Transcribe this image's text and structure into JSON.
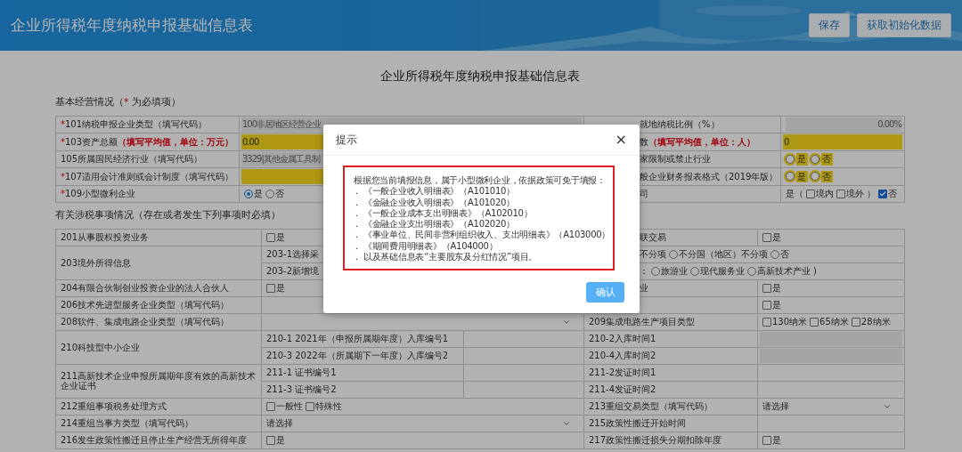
{
  "header": {
    "title": "企业所得税年度纳税申报基础信息表",
    "buttons": [
      "保存",
      "获取初始化数据"
    ]
  },
  "page_title": "企业所得税年度纳税申报基础信息表",
  "tables": [
    {
      "kind": "basic",
      "title": "基本经营情况（",
      "mark": "*",
      "title_end": " 为必填项）",
      "groups": [
        {
          "label": {
            "kind": "label",
            "mark": "*",
            "text": "101纳税申报企业类型（填写代码）"
          },
          "rows": [
            [
              {
                "kind": "value",
                "parts": [
                  {
                    "kind": "readonly_input",
                    "value": "100非居地区经营企业"
                  }
                ]
              },
              {
                "kind": "label",
                "covered": true,
                "text": "就地纳税比例（%）"
              },
              {
                "kind": "value",
                "parts": [
                  {
                    "kind": "readonly_number",
                    "value": "0.00%"
                  }
                ]
              }
            ]
          ]
        },
        {
          "label": {
            "kind": "label",
            "mark": "*",
            "text": "103资产总额",
            "note": "（填写平均值，单位：万元）"
          },
          "rows": [
            [
              {
                "kind": "value",
                "parts": [
                  {
                    "kind": "required_input",
                    "value": "0.00"
                  }
                ]
              },
              {
                "kind": "label",
                "covered": true,
                "text": "数",
                "note": "（填写平均值，单位：人）"
              },
              {
                "kind": "value",
                "parts": [
                  {
                    "kind": "required_input",
                    "value": "0"
                  }
                ]
              }
            ]
          ]
        },
        {
          "label": {
            "kind": "label",
            "text": "105所属国民经济行业（填写代码）"
          },
          "rows": [
            [
              {
                "kind": "value",
                "parts": [
                  {
                    "kind": "readonly_input",
                    "value": "3329|其他金属工具制"
                  }
                ]
              },
              {
                "kind": "label",
                "covered": true,
                "text": "家限制或禁止行业"
              },
              {
                "kind": "value",
                "parts": [
                  {
                    "kind": "radio",
                    "label": "是",
                    "selected": false,
                    "highlighted": true
                  },
                  {
                    "kind": "radio",
                    "label": "否",
                    "selected": false,
                    "highlighted": true
                  }
                ]
              }
            ]
          ]
        },
        {
          "label": {
            "kind": "label",
            "mark": "*",
            "text": "107适用会计准则或会计制度（填写代码）"
          },
          "rows": [
            [
              {
                "kind": "value",
                "parts": [
                  {
                    "kind": "required_input"
                  }
                ]
              },
              {
                "kind": "label",
                "covered": true,
                "text": "般企业财务报表格式（2019年版）"
              },
              {
                "kind": "value",
                "parts": [
                  {
                    "kind": "radio",
                    "label": "是",
                    "selected": false,
                    "highlighted": true
                  },
                  {
                    "kind": "radio",
                    "label": "否",
                    "selected": false,
                    "highlighted": true
                  }
                ]
              }
            ]
          ]
        },
        {
          "label": {
            "kind": "label",
            "mark": "*",
            "text": "109小型微利企业"
          },
          "rows": [
            [
              {
                "kind": "value",
                "parts": [
                  {
                    "kind": "radio",
                    "label": "是",
                    "selected": true,
                    "highlighted": false
                  },
                  {
                    "kind": "radio",
                    "label": "否",
                    "selected": false,
                    "highlighted": false
                  }
                ]
              },
              {
                "kind": "label",
                "covered": true,
                "text": "司"
              },
              {
                "kind": "value",
                "parts": [
                  {
                    "kind": "text",
                    "text": "是（"
                  },
                  {
                    "kind": "check",
                    "label": "境内",
                    "checked": false
                  },
                  {
                    "kind": "check",
                    "label": "境外",
                    "checked": false
                  },
                  {
                    "kind": "text",
                    "text": "）"
                  },
                  {
                    "kind": "check",
                    "label": "否",
                    "checked": true
                  }
                ]
              }
            ]
          ]
        }
      ]
    },
    {
      "kind": "matters",
      "title": "有关涉税事项情况（存在或者发生下列事项时必填）",
      "groups": [
        {
          "label": {
            "kind": "label",
            "text": "201从事股权投资业务"
          },
          "rows": [
            [
              {
                "kind": "value",
                "merged": true,
                "parts": [
                  {
                    "kind": "check",
                    "label": "是",
                    "checked": false
                  }
                ]
              },
              {
                "kind": "label",
                "covered": true,
                "text": "联交易"
              },
              {
                "kind": "value",
                "parts": [
                  {
                    "kind": "check",
                    "label": "是",
                    "checked": false
                  }
                ]
              }
            ]
          ]
        },
        {
          "label": {
            "kind": "label",
            "text": "203境外所得信息"
          },
          "rows": [
            [
              {
                "kind": "label",
                "merged": true,
                "text": "203-1选择采"
              },
              {
                "kind": "value",
                "merged": true,
                "covered": true,
                "parts": [
                  {
                    "kind": "text",
                    "text": "不分项"
                  },
                  {
                    "kind": "radio",
                    "label": "不分国（地区）不分项",
                    "selected": false,
                    "highlighted": false
                  },
                  {
                    "kind": "radio",
                    "label": "否",
                    "selected": false,
                    "highlighted": false
                  }
                ]
              }
            ],
            [
              {
                "kind": "label",
                "merged": true,
                "text": "203-2新增境"
              },
              {
                "kind": "value",
                "merged": true,
                "covered": true,
                "parts": [
                  {
                    "kind": "text",
                    "text": "："
                  },
                  {
                    "kind": "radio",
                    "label": "旅游业",
                    "selected": false,
                    "highlighted": false
                  },
                  {
                    "kind": "radio",
                    "label": "现代服务业",
                    "selected": false,
                    "highlighted": false
                  },
                  {
                    "kind": "radio",
                    "label": "高新技术产业",
                    "selected": false,
                    "highlighted": false
                  },
                  {
                    "kind": "text",
                    "text": ")"
                  }
                ]
              }
            ]
          ]
        },
        {
          "label": {
            "kind": "label",
            "text": "204有限合伙制创业投资企业的法人合伙人"
          },
          "rows": [
            [
              {
                "kind": "value",
                "merged": true,
                "parts": [
                  {
                    "kind": "check",
                    "label": "是",
                    "checked": false
                  }
                ]
              },
              {
                "kind": "label",
                "covered": true,
                "text": "业"
              },
              {
                "kind": "value",
                "parts": [
                  {
                    "kind": "check",
                    "label": "是",
                    "checked": false
                  }
                ]
              }
            ]
          ]
        },
        {
          "label": {
            "kind": "label",
            "text": "206技术先进型服务企业类型（填写代码）"
          },
          "rows": [
            [
              {
                "kind": "value",
                "merged": true
              },
              {
                "kind": "label",
                "covered": true
              },
              {
                "kind": "value",
                "parts": [
                  {
                    "kind": "check",
                    "label": "是",
                    "checked": false
                  }
                ]
              }
            ]
          ]
        },
        {
          "label": {
            "kind": "label",
            "text": "208软件、集成电路企业类型（填写代码）"
          },
          "rows": [
            [
              {
                "kind": "value",
                "merged": true,
                "parts": [
                  {
                    "kind": "select"
                  }
                ]
              },
              {
                "kind": "label",
                "text": "209集成电路生产项目类型"
              },
              {
                "kind": "value",
                "parts": [
                  {
                    "kind": "check",
                    "label": "130纳米",
                    "checked": false
                  },
                  {
                    "kind": "check",
                    "label": "65纳米",
                    "checked": false
                  },
                  {
                    "kind": "check",
                    "label": "28纳米",
                    "checked": false
                  }
                ]
              }
            ]
          ]
        },
        {
          "label": {
            "kind": "label",
            "text": "210科技型中小企业"
          },
          "rows": [
            [
              {
                "kind": "label",
                "text": "210-1  2021年（申报所属期年度）入库编号1"
              },
              {
                "kind": "value"
              },
              {
                "kind": "label",
                "text": "210-2入库时间1"
              },
              {
                "kind": "value",
                "parts": [
                  {
                    "kind": "readonly_input"
                  }
                ]
              }
            ],
            [
              {
                "kind": "label",
                "text": "210-3  2022年（所属期下一年度）入库编号2"
              },
              {
                "kind": "value"
              },
              {
                "kind": "label",
                "text": "210-4入库时间2"
              },
              {
                "kind": "value",
                "parts": [
                  {
                    "kind": "readonly_input"
                  }
                ]
              }
            ]
          ]
        },
        {
          "label": {
            "kind": "label",
            "text": "211高新技术企业申报所属期年度有效的高新技术企业证书"
          },
          "rows": [
            [
              {
                "kind": "label",
                "text": "211-1 证书编号1"
              },
              {
                "kind": "value"
              },
              {
                "kind": "label",
                "text": "211-2发证时间1"
              },
              {
                "kind": "value"
              }
            ],
            [
              {
                "kind": "label",
                "text": "211-3 证书编号2"
              },
              {
                "kind": "value"
              },
              {
                "kind": "label",
                "text": "211-4发证时间2"
              },
              {
                "kind": "value"
              }
            ]
          ]
        },
        {
          "label": {
            "kind": "label",
            "text": "212重组事项税务处理方式"
          },
          "rows": [
            [
              {
                "kind": "value",
                "merged": true,
                "parts": [
                  {
                    "kind": "check",
                    "label": "一般性",
                    "checked": false
                  },
                  {
                    "kind": "check",
                    "label": "特殊性",
                    "checked": false
                  }
                ]
              },
              {
                "kind": "label",
                "text": "213重组交易类型（填写代码）"
              },
              {
                "kind": "value",
                "parts": [
                  {
                    "kind": "select",
                    "value": "请选择"
                  }
                ]
              }
            ]
          ]
        },
        {
          "label": {
            "kind": "label",
            "text": "214重组当事方类型（填写代码）"
          },
          "rows": [
            [
              {
                "kind": "value",
                "merged": true,
                "parts": [
                  {
                    "kind": "select",
                    "value": "请选择"
                  }
                ]
              },
              {
                "kind": "label",
                "text": "215政策性搬迁开始时间"
              },
              {
                "kind": "value"
              }
            ]
          ]
        },
        {
          "label": {
            "kind": "label",
            "text": "216发生政策性搬迁且停止生产经营无所得年度"
          },
          "rows": [
            [
              {
                "kind": "value",
                "merged": true,
                "parts": [
                  {
                    "kind": "check",
                    "label": "是",
                    "checked": false
                  }
                ]
              },
              {
                "kind": "label",
                "text": "217政策性搬迁损失分期扣除年度"
              },
              {
                "kind": "value",
                "parts": [
                  {
                    "kind": "check",
                    "label": "是",
                    "checked": false
                  }
                ]
              }
            ]
          ]
        }
      ]
    }
  ],
  "dialog": {
    "title": "提示",
    "close": "×",
    "intro": "根据您当前填报信息，属于小型微利企业，依据政策可免于填报：",
    "items": [
      {
        "marker": ".",
        "text": "《一般企业收入明细表》（A101010）"
      },
      {
        "marker": ".",
        "text": "《金融企业收入明细表》（A101020）"
      },
      {
        "marker": ".",
        "text": "《一般企业成本支出明细表》（A102010）"
      },
      {
        "marker": ".",
        "text": "《金融企业支出明细表》（A102020）"
      },
      {
        "marker": ".",
        "text": "《事业单位、民间非营利组织收入、支出明细表》（A103000）"
      },
      {
        "marker": ".",
        "text": "《期间费用明细表》（A104000）"
      },
      {
        "marker": ".",
        "text": "以及基础信息表“主要股东及分红情况”项目。"
      }
    ],
    "confirm": "确认"
  }
}
